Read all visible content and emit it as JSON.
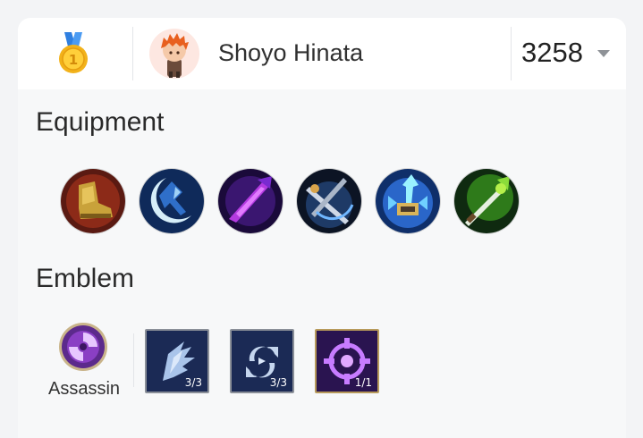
{
  "player": {
    "name": "Shoyo Hinata",
    "score": "3258",
    "rank_icon": "gold-medal-1-icon",
    "avatar": "chibi-character-avatar"
  },
  "equipment": {
    "title": "Equipment",
    "items": [
      {
        "icon": "golden-boots-icon"
      },
      {
        "icon": "blue-crescent-blade-icon"
      },
      {
        "icon": "purple-demon-blade-icon"
      },
      {
        "icon": "crossed-blades-icon"
      },
      {
        "icon": "azure-spear-icon"
      },
      {
        "icon": "green-sword-icon"
      }
    ]
  },
  "emblem": {
    "title": "Emblem",
    "main_label": "Assassin",
    "main_icon": "assassin-emblem-icon",
    "talents": [
      {
        "icon": "wing-talent-icon",
        "count": "3/3"
      },
      {
        "icon": "cycle-arrows-talent-icon",
        "count": "3/3"
      },
      {
        "icon": "crosshair-talent-icon",
        "count": "1/1"
      }
    ]
  }
}
